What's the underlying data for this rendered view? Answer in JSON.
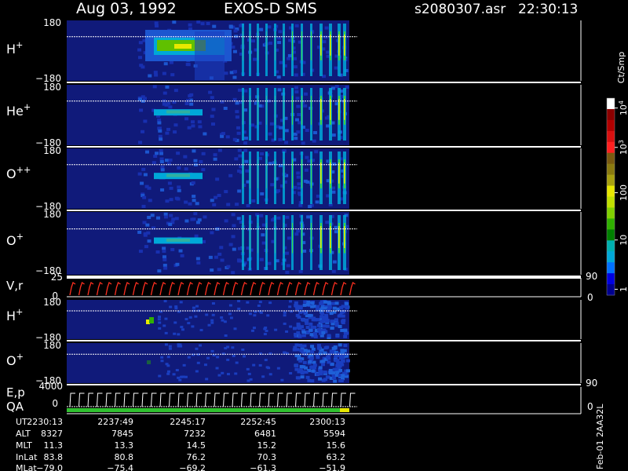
{
  "header": {
    "date": "Aug 03, 1992",
    "instrument": "EXOS-D SMS",
    "file": "s2080307.asr",
    "time": "22:30:13"
  },
  "chart_data": {
    "type": "heatmap",
    "panels": [
      {
        "label": "H",
        "sup": "+",
        "ytop": "180",
        "ybot": "−180"
      },
      {
        "label": "He",
        "sup": "+",
        "ytop": "180",
        "ybot": "−180"
      },
      {
        "label": "O",
        "sup": "++",
        "ytop": "180",
        "ybot": "−180"
      },
      {
        "label": "O",
        "sup": "+",
        "ytop": "180",
        "ybot": "−180"
      }
    ],
    "vr_panel": {
      "label": "V,r",
      "ytop": "25",
      "ybot": "0",
      "rtop": "90",
      "rbot": "0"
    },
    "lower_panels": [
      {
        "label": "H",
        "sup": "+",
        "ytop": "180",
        "ybot": "−180"
      },
      {
        "label": "O",
        "sup": "+",
        "ytop": "180",
        "ybot": "−180"
      }
    ],
    "ep_panel": {
      "label": "E,p",
      "qa": "QA",
      "ytop": "4000",
      "ybot": "0",
      "rtop": "90",
      "rbot": "0"
    },
    "colorbar": {
      "title": "Ct/Smp",
      "ticks": [
        {
          "base": "10",
          "sup": "4"
        },
        {
          "base": "10",
          "sup": "3"
        },
        {
          "base": "100",
          "sup": ""
        },
        {
          "base": "10",
          "sup": ""
        },
        {
          "base": "1",
          "sup": ""
        }
      ],
      "colors": [
        "#ffffff",
        "#8b0000",
        "#b00000",
        "#d81010",
        "#ff2020",
        "#7a5a10",
        "#8a7a10",
        "#a8a010",
        "#e8e800",
        "#c0e000",
        "#80d000",
        "#30b000",
        "#008000",
        "#00b0b0",
        "#00a8d8",
        "#0070ff",
        "#0000e0",
        "#000090"
      ]
    },
    "footer": {
      "rows": [
        {
          "name": "UT",
          "values": [
            "2230:13",
            "2237:49",
            "2245:17",
            "2252:45",
            "2300:13"
          ]
        },
        {
          "name": "ALT",
          "values": [
            "8327",
            "7845",
            "7232",
            "6481",
            "5594"
          ]
        },
        {
          "name": "MLT",
          "values": [
            "11.3",
            "13.3",
            "14.5",
            "15.2",
            "15.6"
          ]
        },
        {
          "name": "InLat",
          "values": [
            "83.8",
            "80.8",
            "76.2",
            "70.3",
            "63.2"
          ]
        },
        {
          "name": "MLat",
          "values": [
            "−79.0",
            "−75.4",
            "−69.2",
            "−61.3",
            "−51.9"
          ]
        }
      ],
      "stamp": "Feb-01 2AA32L"
    }
  }
}
